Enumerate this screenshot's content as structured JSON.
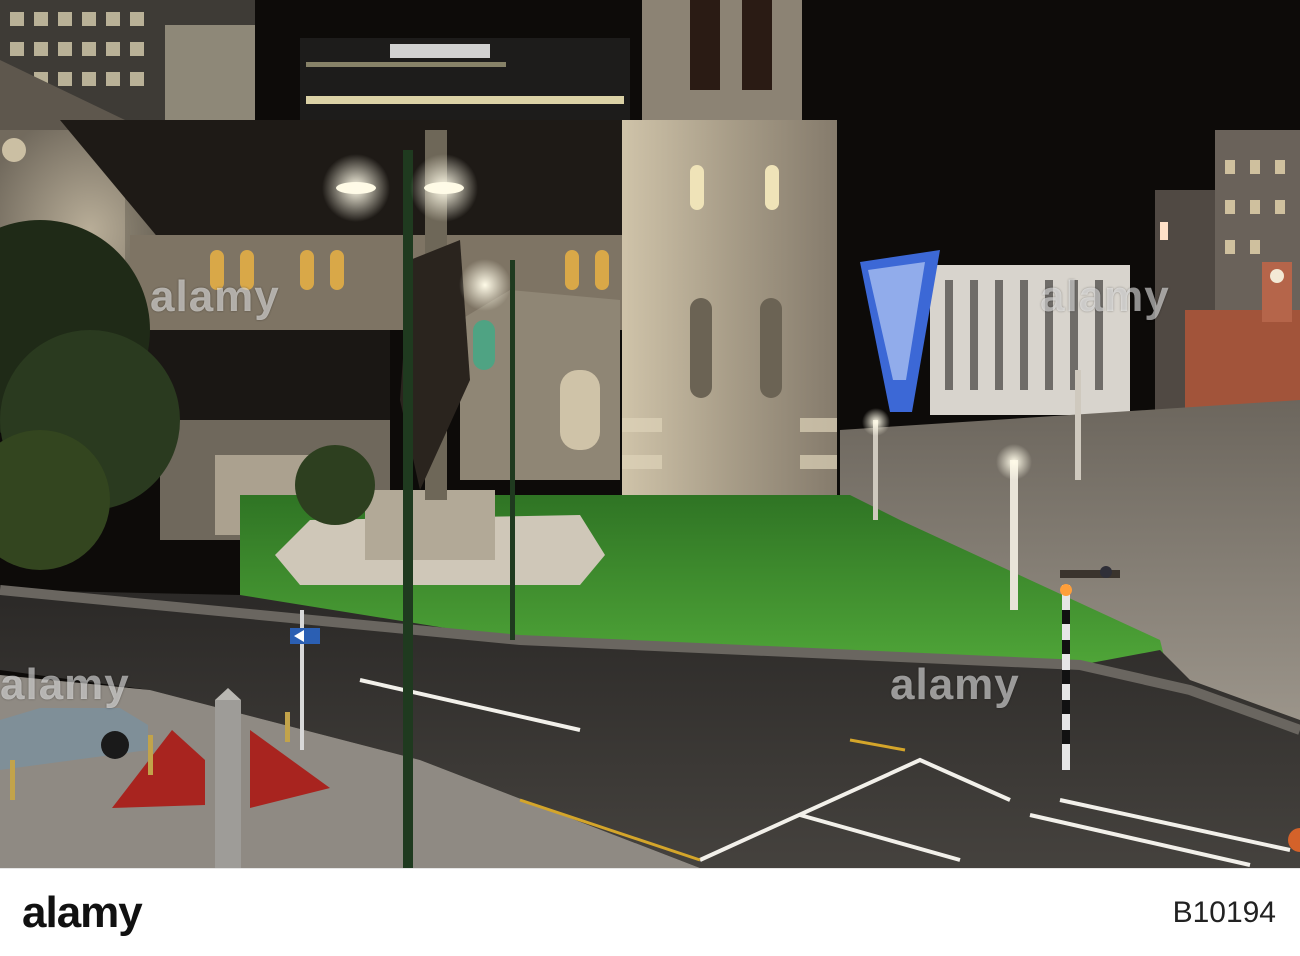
{
  "photo": {
    "subject": "Christchurch Cathedral Square at night",
    "colors": {
      "sky": "#0d0b09",
      "stone": "#8a8275",
      "stone_lit": "#d8cdb4",
      "roof": "#1e1a16",
      "lawn": "#3f8f2c",
      "road": "#3a3835",
      "plaza": "#a49d93",
      "window_lit": "#f3e6b0",
      "sculpture": "#3c68d6",
      "red_sculpture": "#a8241f"
    }
  },
  "watermarks": [
    "alamy",
    "alamy",
    "alamy",
    "alamy"
  ],
  "sign_text": "",
  "footer": {
    "logo": "alamy",
    "image_id": "B10194"
  }
}
